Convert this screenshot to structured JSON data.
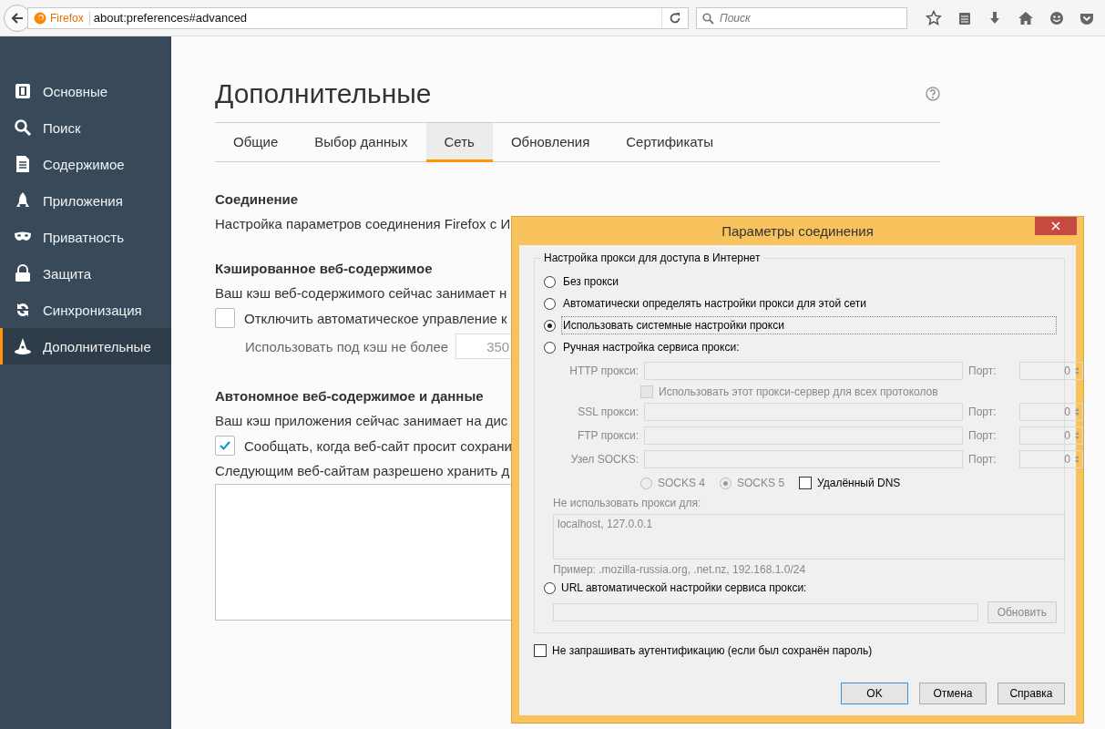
{
  "toolbar": {
    "identity": "Firefox",
    "url": "about:preferences#advanced",
    "search": {
      "placeholder": "Поиск"
    }
  },
  "sidebar": {
    "items": [
      {
        "label": "Основные",
        "selected": false
      },
      {
        "label": "Поиск",
        "selected": false
      },
      {
        "label": "Содержимое",
        "selected": false
      },
      {
        "label": "Приложения",
        "selected": false
      },
      {
        "label": "Приватность",
        "selected": false
      },
      {
        "label": "Защита",
        "selected": false
      },
      {
        "label": "Синхронизация",
        "selected": false
      },
      {
        "label": "Дополнительные",
        "selected": true
      }
    ]
  },
  "page": {
    "title": "Дополнительные",
    "tabs": [
      {
        "label": "Общие",
        "selected": false
      },
      {
        "label": "Выбор данных",
        "selected": false
      },
      {
        "label": "Сеть",
        "selected": true
      },
      {
        "label": "Обновления",
        "selected": false
      },
      {
        "label": "Сертификаты",
        "selected": false
      }
    ],
    "connection": {
      "heading": "Соединение",
      "text": "Настройка параметров соединения Firefox с И"
    },
    "cache": {
      "heading": "Кэшированное веб-содержимое",
      "text": "Ваш кэш веб-содержимого сейчас занимает н",
      "override": {
        "label": "Отключить автоматическое управление к",
        "checked": false
      },
      "limit_label": "Использовать под кэш не более",
      "limit_value": "350"
    },
    "offline": {
      "heading": "Автономное веб-содержимое и данные",
      "text": "Ваш кэш приложения сейчас занимает на дис",
      "notify": {
        "label": "Сообщать, когда веб-сайт просит сохрани",
        "checked": true
      },
      "list_label": "Следующим веб-сайтам разрешено хранить д"
    }
  },
  "dialog": {
    "title": "Параметры соединения",
    "group_title": "Настройка прокси для доступа в Интернет",
    "modes": [
      {
        "label": "Без прокси",
        "selected": false
      },
      {
        "label": "Автоматически определять настройки прокси для этой сети",
        "selected": false
      },
      {
        "label": "Использовать системные настройки прокси",
        "selected": true
      },
      {
        "label": "Ручная настройка сервиса прокси:",
        "selected": false
      }
    ],
    "proxies": [
      {
        "label": "HTTP прокси:",
        "port_label": "Порт:",
        "port": "0"
      },
      {
        "label": "SSL прокси:",
        "port_label": "Порт:",
        "port": "0"
      },
      {
        "label": "FTP прокси:",
        "port_label": "Порт:",
        "port": "0"
      },
      {
        "label": "Узел SOCKS:",
        "port_label": "Порт:",
        "port": "0"
      }
    ],
    "share": {
      "label": "Использовать этот прокси-сервер для всех протоколов",
      "checked": false
    },
    "socks": [
      {
        "label": "SOCKS 4",
        "selected": false
      },
      {
        "label": "SOCKS 5",
        "selected": true
      }
    ],
    "remote_dns": {
      "label": "Удалённый DNS",
      "checked": false
    },
    "no_proxy_label": "Не использовать прокси для:",
    "no_proxy_value": "localhost, 127.0.0.1",
    "example": "Пример: .mozilla-russia.org, .net.nz, 192.168.1.0/24",
    "auto_url": {
      "label": "URL автоматической настройки сервиса прокси:",
      "selected": false
    },
    "reload": "Обновить",
    "no_auth": {
      "label": "Не запрашивать аутентификацию (если был сохранён пароль)",
      "checked": false
    },
    "buttons": [
      "OK",
      "Отмена",
      "Справка"
    ]
  }
}
